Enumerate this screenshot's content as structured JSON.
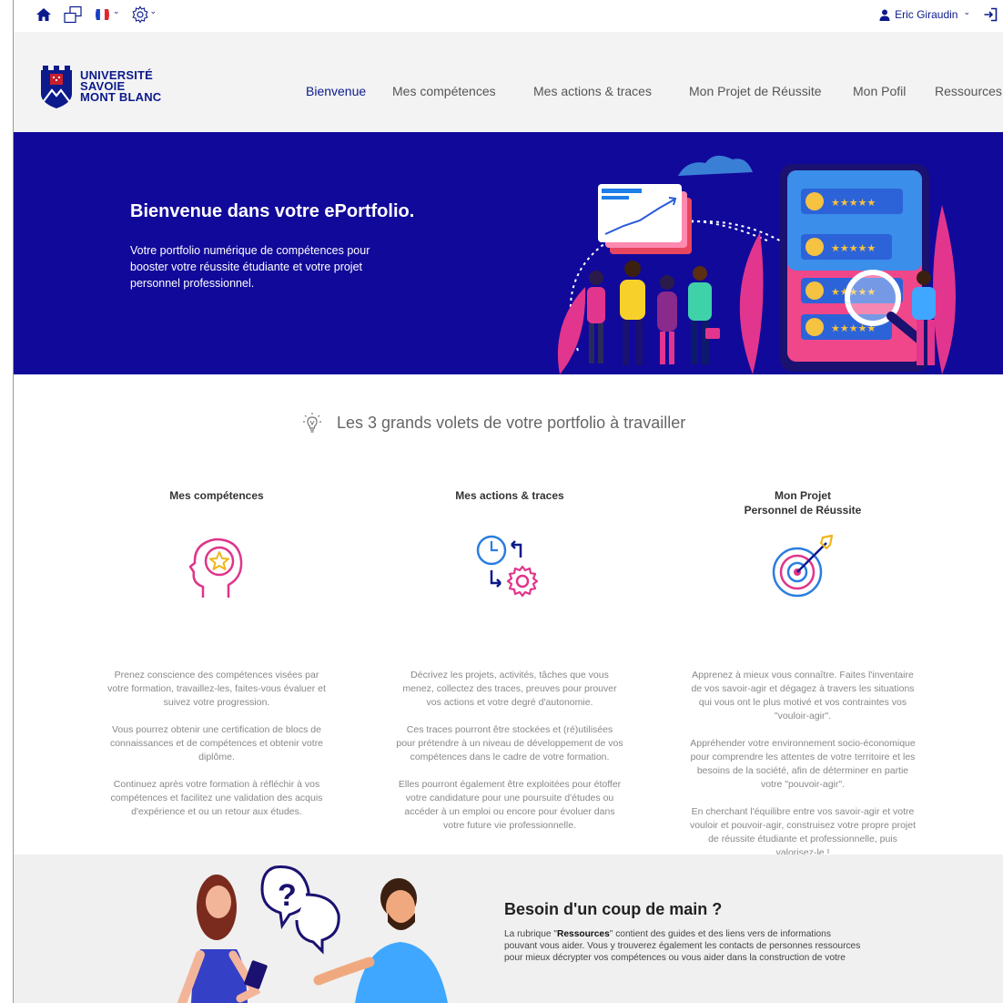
{
  "utility": {
    "user_name": "Eric Giraudin",
    "caret": "⌄"
  },
  "logo": {
    "line1": "UNIVERSITÉ",
    "line2": "SAVOIE",
    "line3": "MONT BLANC"
  },
  "nav": {
    "items": [
      {
        "label": "Bienvenue",
        "active": true
      },
      {
        "label": "Mes compétences"
      },
      {
        "label": "Mes actions & traces"
      },
      {
        "label": "Mon Projet de Réussite"
      },
      {
        "label": "Mon Pofil"
      },
      {
        "label": "Ressources"
      }
    ]
  },
  "hero": {
    "title": "Bienvenue dans votre ePortfolio.",
    "text": "Votre portfolio numérique de compétences pour booster votre réussite étudiante et votre projet personnel professionnel."
  },
  "volets": {
    "title": "Les 3 grands volets de votre portfolio à travailler",
    "columns": [
      {
        "title": "Mes compétences",
        "icon": "head-star-icon",
        "paragraphs": [
          "Prenez conscience des compétences visées par votre formation, travaillez-les, faites-vous évaluer et suivez votre progression.",
          "Vous pourrez obtenir une certification de blocs de connaissances et de compétences et obtenir votre diplôme.",
          "Continuez après votre formation à réfléchir à vos compétences et facilitez une validation des acquis d'expérience et ou un retour aux études."
        ]
      },
      {
        "title": "Mes actions & traces",
        "icon": "clock-gear-icon",
        "paragraphs": [
          "Décrivez les projets, activités, tâches que vous menez, collectez des traces, preuves pour prouver vos actions et votre degré d'autonomie.",
          "Ces traces pourront être stockées et (ré)utilisées pour prétendre à un niveau de développement de vos compétences dans le cadre de votre formation.",
          "Elles pourront également être exploitées pour étoffer votre candidature pour une poursuite d'études ou accéder à un emploi ou encore pour évoluer dans votre future vie professionnelle."
        ]
      },
      {
        "title_line1": "Mon Projet",
        "title_line2": "Personnel de Réussite",
        "icon": "target-arrow-icon",
        "paragraphs": [
          "Apprenez à mieux vous connaître. Faites l'inventaire de vos savoir-agir et dégagez à travers les situations qui vous ont le plus motivé et vos contraintes vos \"vouloir-agir\".",
          "Appréhender votre environnement socio-économique pour comprendre les attentes de votre territoire et les besoins de la société, afin de déterminer en partie votre \"pouvoir-agir\".",
          "En cherchant l'équilibre entre vos savoir-agir et votre vouloir et pouvoir-agir, construisez votre propre projet de réussite étudiante et professionnelle, puis valorisez-le !"
        ]
      }
    ]
  },
  "help": {
    "title": "Besoin d'un coup de main ?",
    "text_before": "La rubrique \"",
    "text_bold": "Ressources",
    "text_after": "\" contient des guides et des liens vers de informations pouvant vous aider. Vous y trouverez également les contacts de personnes ressources pour mieux décrypter vos compétences ou vous aider dans la construction de votre"
  },
  "colors": {
    "brand_blue": "#11099a",
    "nav_active": "#0c1a8c",
    "accent_pink": "#e0348a",
    "accent_blue": "#2a7de1"
  }
}
